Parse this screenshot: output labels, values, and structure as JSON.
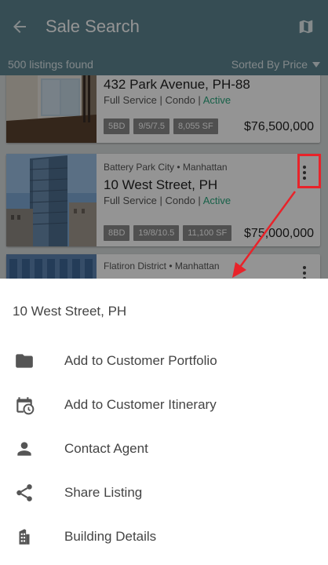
{
  "app_bar": {
    "title": "Sale Search",
    "back_icon": "arrow-left-icon",
    "map_icon": "map-icon",
    "bg_color": "#5e8592"
  },
  "sub_bar": {
    "count_text": "500 listings found",
    "sort_label": "Sorted By Price"
  },
  "listings": [
    {
      "neighborhood": "",
      "address": "432 Park Avenue, PH-88",
      "type_line": "Full Service | Condo |",
      "status": "Active",
      "chips": [
        "5BD",
        "9/5/7.5",
        "8,055 SF"
      ],
      "price": "$76,500,000"
    },
    {
      "neighborhood": "Battery Park City • Manhattan",
      "address": "10 West Street, PH",
      "type_line": "Full Service | Condo |",
      "status": "Active",
      "chips": [
        "8BD",
        "19/8/10.5",
        "11,100 SF"
      ],
      "price": "$75,000,000"
    },
    {
      "neighborhood": "Flatiron District • Manhattan",
      "address": "",
      "type_line": "",
      "status": "",
      "chips": [],
      "price": ""
    }
  ],
  "sheet": {
    "title": "10 West Street, PH",
    "items": [
      {
        "label": "Add to Customer Portfolio",
        "icon": "folder-icon"
      },
      {
        "label": "Add to Customer Itinerary",
        "icon": "calendar-clock-icon"
      },
      {
        "label": "Contact Agent",
        "icon": "person-icon"
      },
      {
        "label": "Share Listing",
        "icon": "share-icon"
      },
      {
        "label": "Building Details",
        "icon": "building-icon"
      }
    ]
  },
  "colors": {
    "status_active": "#2aa87e",
    "annotation_red": "#e8232a"
  }
}
